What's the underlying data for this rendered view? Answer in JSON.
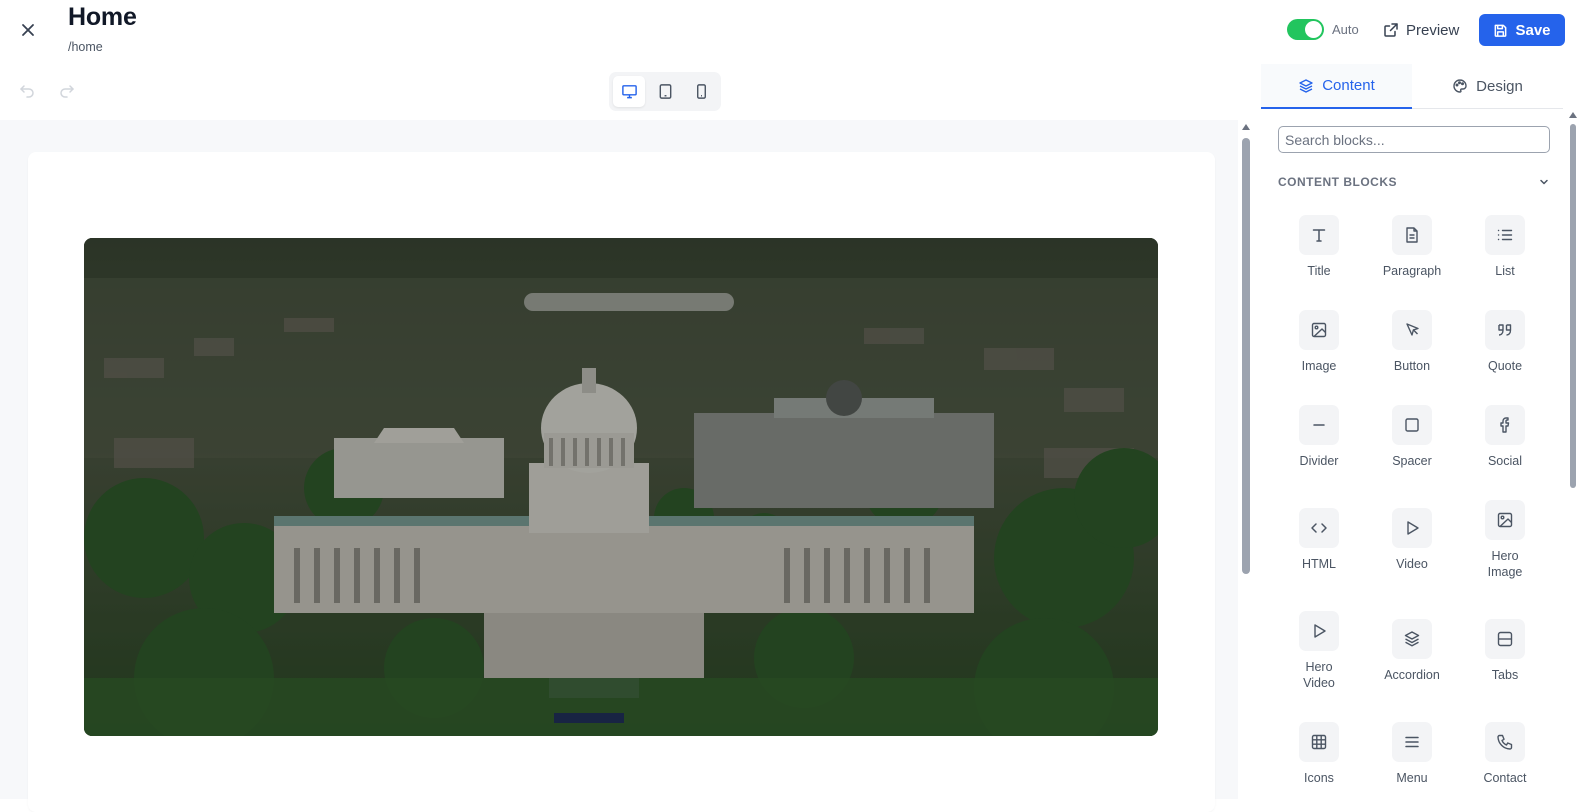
{
  "header": {
    "title": "Home",
    "path": "/home",
    "auto_label": "Auto",
    "auto_enabled": true,
    "preview_label": "Preview",
    "save_label": "Save",
    "accent_color": "#2563eb",
    "toggle_color": "#22c55e"
  },
  "toolbar": {
    "devices": [
      "desktop",
      "tablet",
      "mobile"
    ],
    "active_device": "desktop"
  },
  "panel": {
    "tabs": [
      {
        "label": "Content",
        "icon": "layers-icon",
        "active": true
      },
      {
        "label": "Design",
        "icon": "palette-icon",
        "active": false
      }
    ],
    "search_placeholder": "Search blocks...",
    "section_title": "CONTENT BLOCKS",
    "blocks": [
      {
        "label": "Title",
        "icon": "title-icon"
      },
      {
        "label": "Paragraph",
        "icon": "paragraph-icon"
      },
      {
        "label": "List",
        "icon": "list-icon"
      },
      {
        "label": "Image",
        "icon": "image-icon"
      },
      {
        "label": "Button",
        "icon": "cursor-icon"
      },
      {
        "label": "Quote",
        "icon": "quote-icon"
      },
      {
        "label": "Divider",
        "icon": "divider-icon"
      },
      {
        "label": "Spacer",
        "icon": "spacer-icon"
      },
      {
        "label": "Social",
        "icon": "facebook-icon"
      },
      {
        "label": "HTML",
        "icon": "code-icon"
      },
      {
        "label": "Video",
        "icon": "play-icon"
      },
      {
        "label": "Hero Image",
        "icon": "hero-image-icon"
      },
      {
        "label": "Hero Video",
        "icon": "hero-video-icon"
      },
      {
        "label": "Accordion",
        "icon": "accordion-icon"
      },
      {
        "label": "Tabs",
        "icon": "tabs-icon"
      },
      {
        "label": "Icons",
        "icon": "grid-icon"
      },
      {
        "label": "Menu",
        "icon": "menu-icon"
      },
      {
        "label": "Contact",
        "icon": "phone-icon"
      }
    ]
  },
  "canvas": {
    "hero_image": "aerial view of capitol building"
  }
}
